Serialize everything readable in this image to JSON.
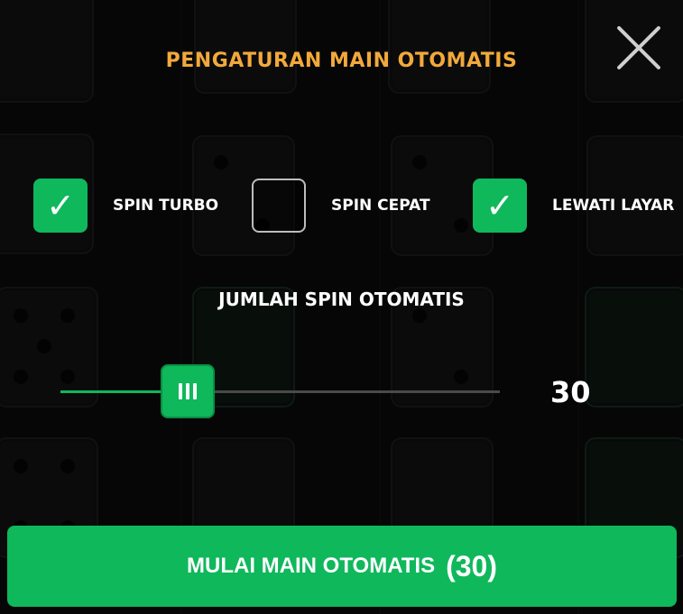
{
  "dialog": {
    "title": "PENGATURAN MAIN OTOMATIS",
    "close_icon": "close-icon"
  },
  "options": [
    {
      "label": "SPIN TURBO",
      "checked": true
    },
    {
      "label": "SPIN CEPAT",
      "checked": false
    },
    {
      "label": "LEWATI LAYAR",
      "checked": true
    }
  ],
  "auto_spin": {
    "label": "JUMLAH SPIN OTOMATIS",
    "value": "30",
    "slider_fraction": 0.29
  },
  "start_button": {
    "label": "MULAI MAIN OTOMATIS",
    "count": "(30)"
  },
  "colors": {
    "accent": "#0fb85b",
    "title": "#f2a93b",
    "background": "#0b0b0c"
  }
}
